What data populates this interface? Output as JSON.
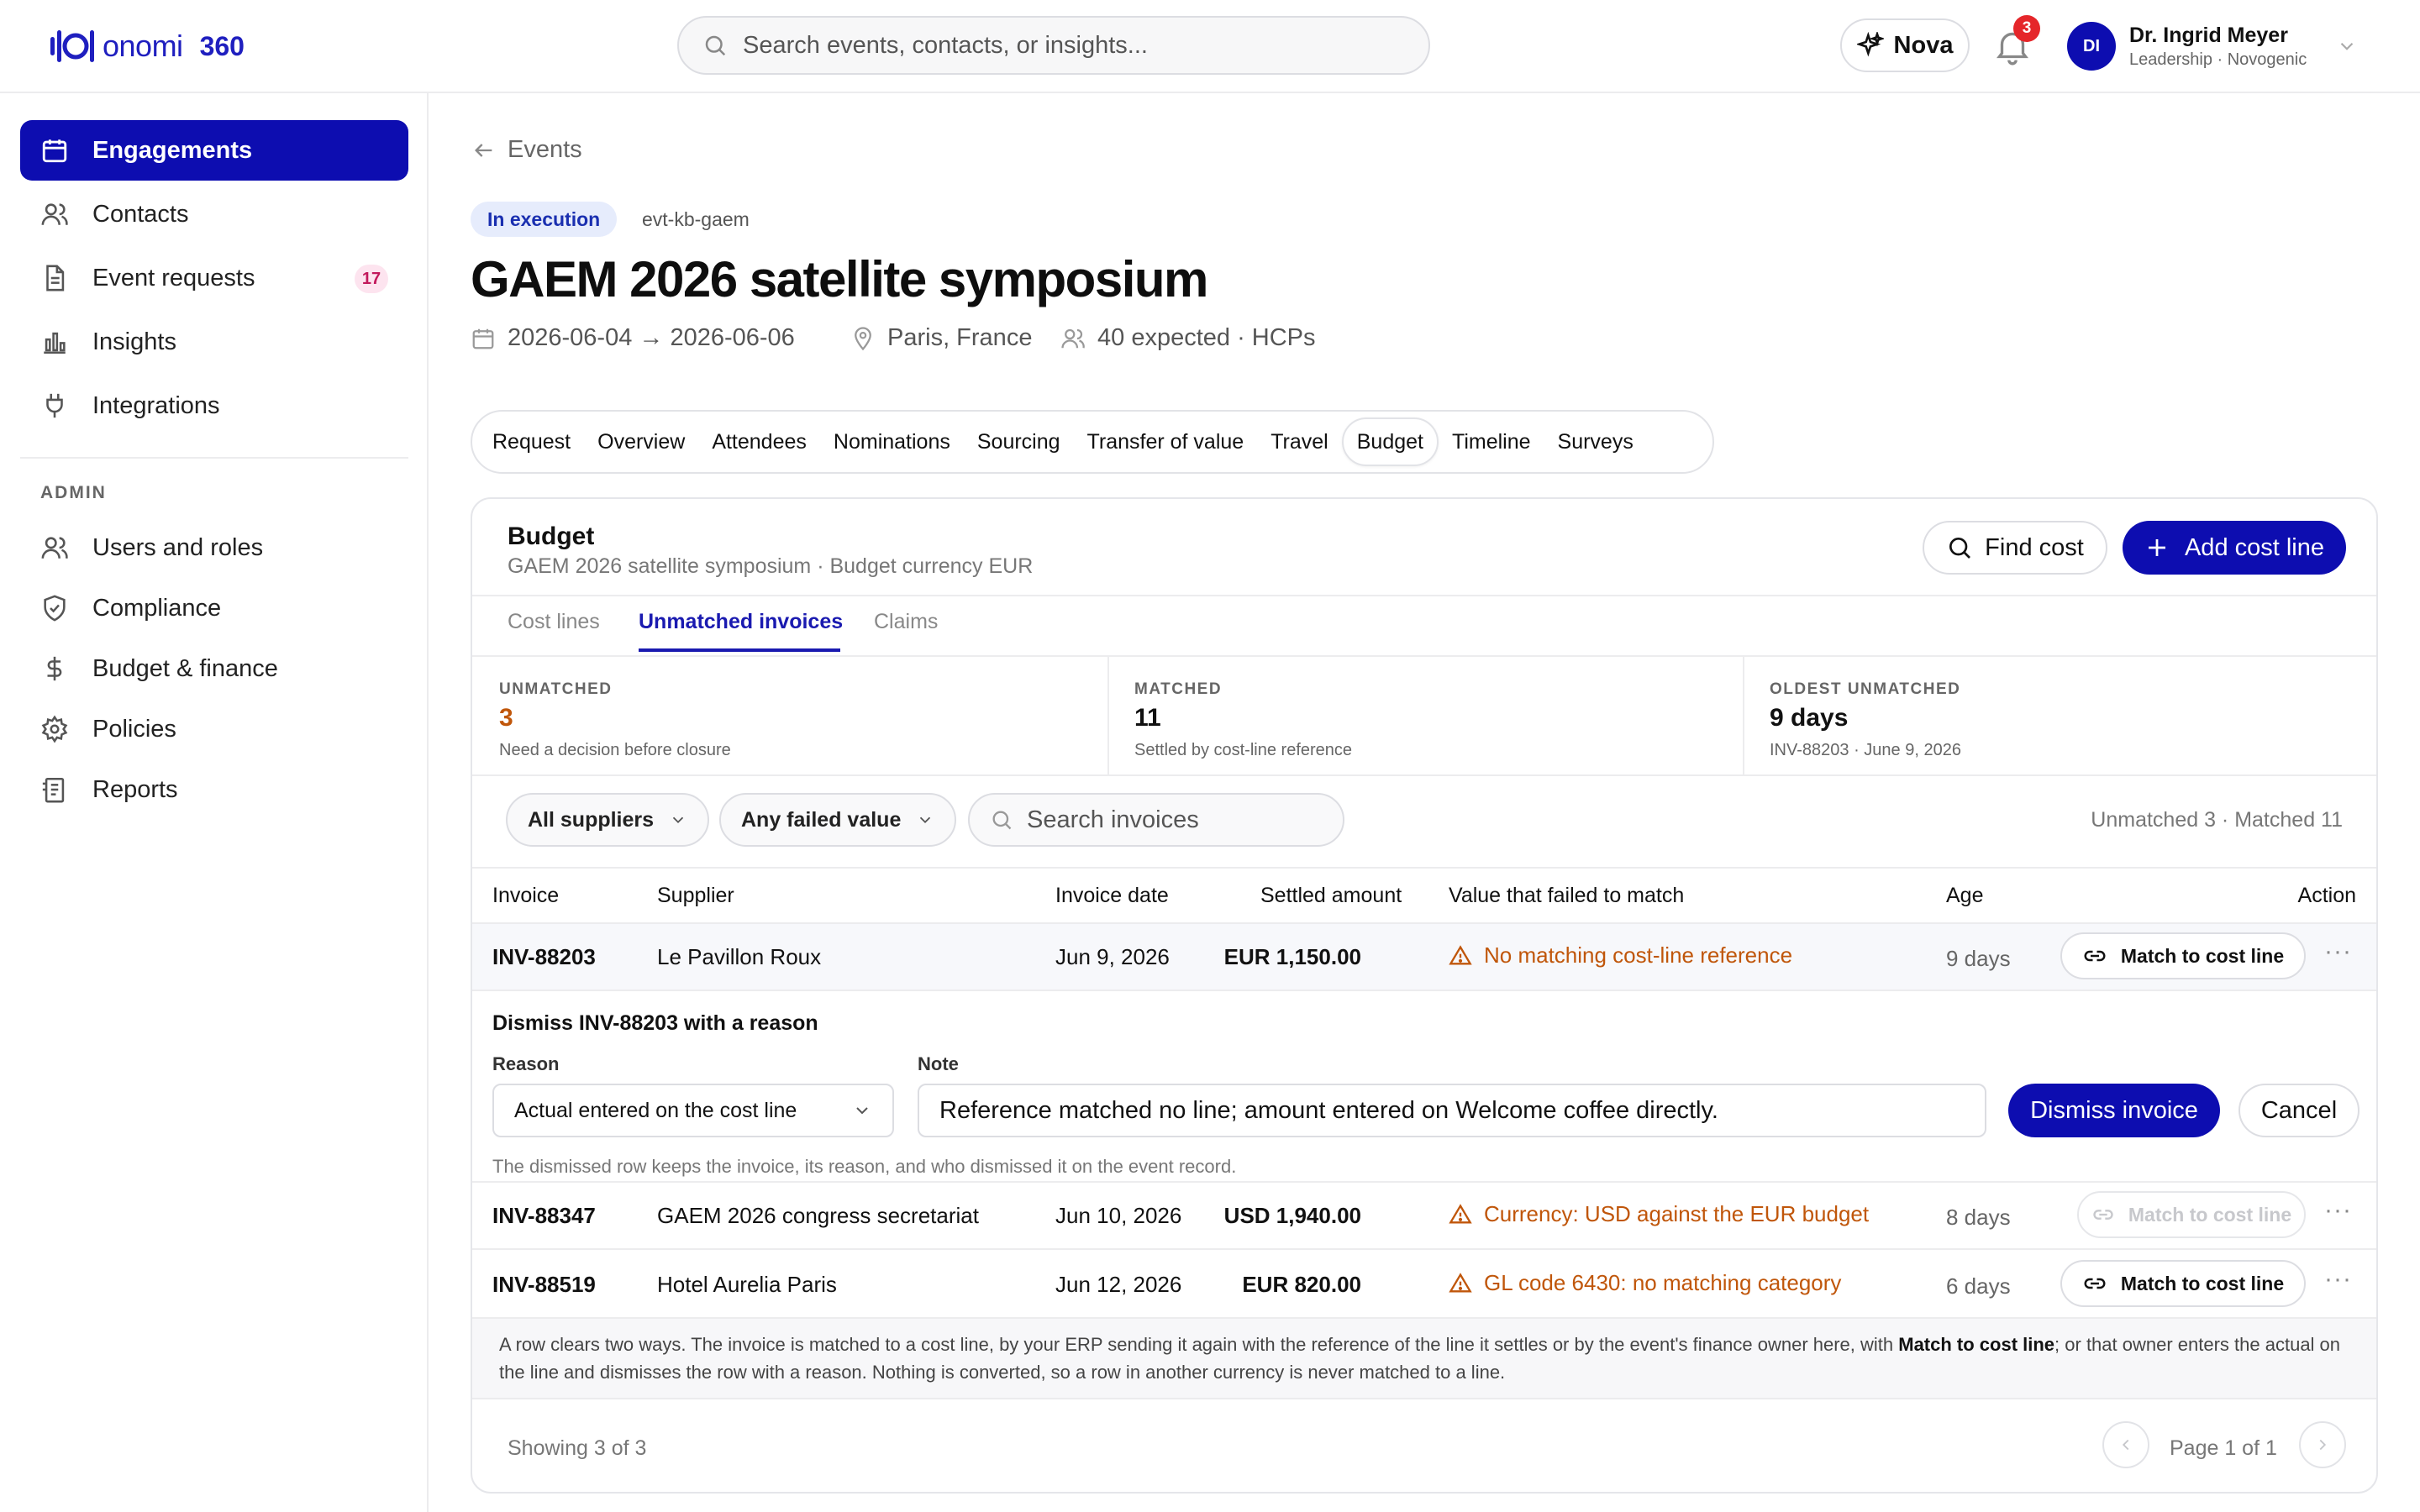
{
  "app": {
    "logo_text": "onomi",
    "logo_suffix": "360"
  },
  "search": {
    "placeholder": "Search events, contacts, or insights..."
  },
  "header": {
    "nova_label": "Nova",
    "notif_count": "3",
    "user_initials": "DI",
    "user_name": "Dr. Ingrid Meyer",
    "user_sub": "Leadership · Novogenic"
  },
  "sidebar": {
    "items": [
      {
        "label": "Engagements",
        "icon": "calendar-icon"
      },
      {
        "label": "Contacts",
        "icon": "users-icon"
      },
      {
        "label": "Event requests",
        "icon": "document-icon",
        "badge": "17"
      },
      {
        "label": "Insights",
        "icon": "bar-chart-icon"
      },
      {
        "label": "Integrations",
        "icon": "plug-icon"
      }
    ],
    "section": "ADMIN",
    "admin_items": [
      {
        "label": "Users and roles",
        "icon": "users-icon"
      },
      {
        "label": "Compliance",
        "icon": "shield-icon"
      },
      {
        "label": "Budget & finance",
        "icon": "dollar-icon"
      },
      {
        "label": "Policies",
        "icon": "gear-icon"
      },
      {
        "label": "Reports",
        "icon": "report-icon"
      }
    ]
  },
  "event": {
    "back_label": "Events",
    "status": "In execution",
    "id": "evt-kb-gaem",
    "title": "GAEM 2026 satellite symposium",
    "dates": "2026-06-04 → 2026-06-06",
    "location": "Paris, France",
    "audience": "40 expected · HCPs"
  },
  "tabs": [
    "Request",
    "Overview",
    "Attendees",
    "Nominations",
    "Sourcing",
    "Transfer of value",
    "Travel",
    "Budget",
    "Timeline",
    "Surveys"
  ],
  "budget": {
    "title": "Budget",
    "subtitle": "GAEM 2026 satellite symposium · Budget currency EUR",
    "find_cost": "Find cost",
    "add_cost_line": "Add cost line",
    "subtabs": [
      "Cost lines",
      "Unmatched invoices",
      "Claims"
    ],
    "stats": [
      {
        "label": "UNMATCHED",
        "value": "3",
        "sub": "Need a decision before closure"
      },
      {
        "label": "MATCHED",
        "value": "11",
        "sub": "Settled by cost-line reference"
      },
      {
        "label": "OLDEST UNMATCHED",
        "value": "9 days",
        "sub": "INV-88203 · June 9, 2026"
      }
    ],
    "filters": {
      "suppliers": "All suppliers",
      "failed_value": "Any failed value",
      "search_placeholder": "Search invoices",
      "counts": "Unmatched 3 · Matched 11"
    },
    "columns": [
      "Invoice",
      "Supplier",
      "Invoice date",
      "Settled amount",
      "Value that failed to match",
      "Age",
      "Action"
    ],
    "rows": [
      {
        "invoice": "INV-88203",
        "supplier": "Le Pavillon Roux",
        "date": "Jun 9, 2026",
        "amount": "EUR 1,150.00",
        "failed": "No matching cost-line reference",
        "age": "9 days",
        "action": "Match to cost line"
      },
      {
        "invoice": "INV-88347",
        "supplier": "GAEM 2026 congress secretariat",
        "date": "Jun 10, 2026",
        "amount": "USD 1,940.00",
        "failed": "Currency: USD against the EUR budget",
        "age": "8 days",
        "action": "Match to cost line"
      },
      {
        "invoice": "INV-88519",
        "supplier": "Hotel Aurelia Paris",
        "date": "Jun 12, 2026",
        "amount": "EUR 820.00",
        "failed": "GL code 6430: no matching category",
        "age": "6 days",
        "action": "Match to cost line"
      }
    ],
    "dismiss": {
      "title": "Dismiss INV-88203 with a reason",
      "reason_label": "Reason",
      "reason_value": "Actual entered on the cost line",
      "note_label": "Note",
      "note_value": "Reference matched no line; amount entered on Welcome coffee directly.",
      "dismiss_button": "Dismiss invoice",
      "cancel_button": "Cancel",
      "hint": "The dismissed row keeps the invoice, its reason, and who dismissed it on the event record."
    },
    "footnote_1": "A row clears two ways. The invoice is matched to a cost line, by your ERP sending it again with the reference of the line it settles or by the event's finance owner here, with ",
    "footnote_bold": "Match to cost line",
    "footnote_2": "; or that owner enters the actual on the line and dismisses the row with a reason. Nothing is converted, so a row in another currency is never matched to a line.",
    "showing": "Showing 3 of 3",
    "page_label": "Page 1 of 1"
  },
  "colors": {
    "brand": "#0d0db0",
    "warning": "#c0560a",
    "badge_red": "#e5262a"
  }
}
